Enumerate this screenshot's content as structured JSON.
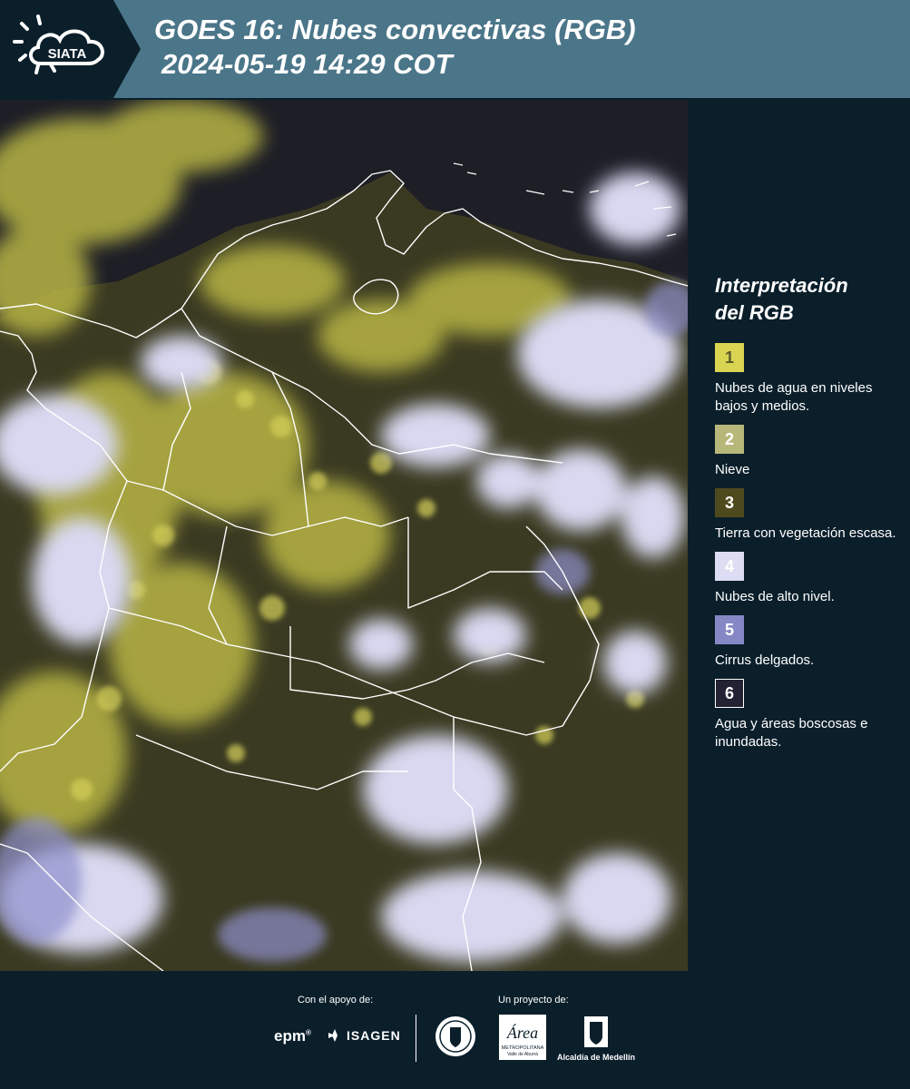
{
  "header": {
    "logo_text": "SIATA",
    "title_line1": "GOES 16: Nubes convectivas (RGB)",
    "title_line2": "2024-05-19 14:29 COT"
  },
  "legend": {
    "title_line1": "Interpretación",
    "title_line2": "del RGB",
    "items": [
      {
        "number": "1",
        "color": "#d9d452",
        "text_color": "#5a5a2a",
        "label": "Nubes de agua en niveles bajos y medios."
      },
      {
        "number": "2",
        "color": "#b8b77a",
        "text_color": "#ffffff",
        "label": "Nieve"
      },
      {
        "number": "3",
        "color": "#4f4a1e",
        "text_color": "#ffffff",
        "label": "Tierra con vegetación escasa."
      },
      {
        "number": "4",
        "color": "#dcdcf2",
        "text_color": "#ffffff",
        "label": "Nubes de alto nivel."
      },
      {
        "number": "5",
        "color": "#8688c6",
        "text_color": "#ffffff",
        "label": "Cirrus delgados."
      },
      {
        "number": "6",
        "color": "#232233",
        "text_color": "#ffffff",
        "label": "Agua y áreas boscosas e inundadas."
      }
    ]
  },
  "footer": {
    "support_label": "Con el apoyo de:",
    "project_label": "Un proyecto de:",
    "epm": "epm",
    "isagen": "ISAGEN",
    "area_text_1": "Área",
    "area_text_2": "METROPOLITANA",
    "area_text_3": "Valle de Aburrá",
    "alcaldia": "Alcaldía de Medellín"
  },
  "colors": {
    "background": "#0b1f2b",
    "header_band": "#4b7689",
    "map_base": "#2a2b22",
    "low_cloud": "#d9d452",
    "high_cloud": "#dcdcf2"
  }
}
